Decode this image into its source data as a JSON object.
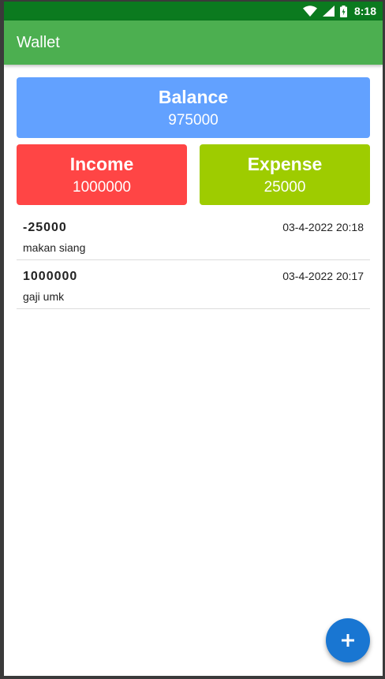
{
  "status_bar": {
    "time": "8:18",
    "icons": [
      "wifi-icon",
      "cellular-signal-icon",
      "battery-charging-icon"
    ]
  },
  "app_bar": {
    "title": "Wallet"
  },
  "summary": {
    "balance": {
      "label": "Balance",
      "value": "975000"
    },
    "income": {
      "label": "Income",
      "value": "1000000"
    },
    "expense": {
      "label": "Expense",
      "value": "25000"
    }
  },
  "transactions": [
    {
      "amount": "-25000",
      "datetime": "03-4-2022 20:18",
      "description": "makan siang"
    },
    {
      "amount": "1000000",
      "datetime": "03-4-2022 20:17",
      "description": "gaji umk"
    }
  ],
  "fab": {
    "icon": "plus-icon"
  },
  "colors": {
    "status_bar": "#0b7a1f",
    "app_bar": "#4caf50",
    "balance": "#62a1ff",
    "income": "#ff4545",
    "expense": "#9ecc00",
    "fab": "#1976d2"
  }
}
